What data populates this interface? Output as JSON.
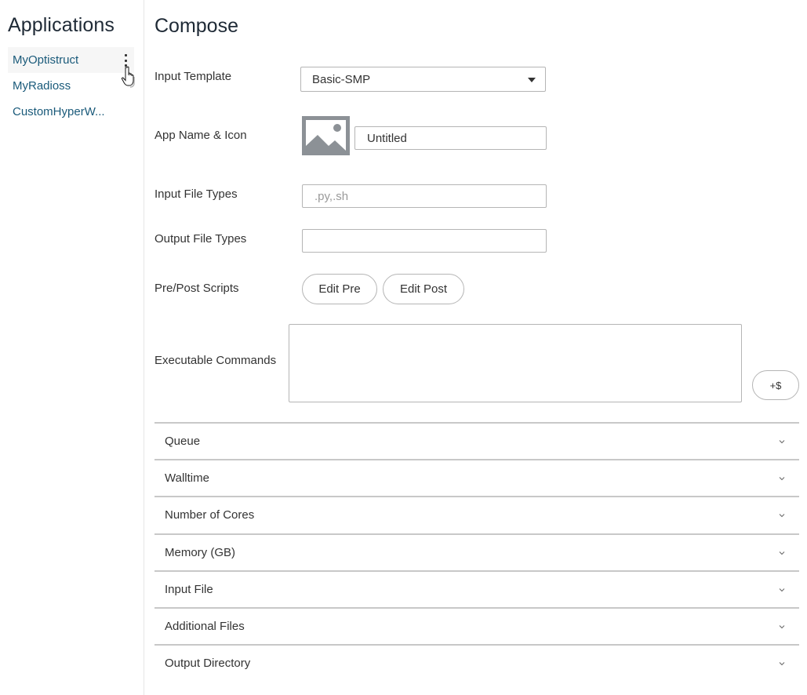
{
  "sidebar": {
    "title": "Applications",
    "items": [
      {
        "label": "MyOptistruct",
        "active": true
      },
      {
        "label": "MyRadioss",
        "active": false
      },
      {
        "label": "CustomHyperW..."
      }
    ]
  },
  "main": {
    "title": "Compose",
    "fields": {
      "input_template": {
        "label": "Input Template",
        "value": "Basic-SMP"
      },
      "app_name_icon": {
        "label": "App Name & Icon",
        "value": "Untitled"
      },
      "input_file_types": {
        "label": "Input File Types",
        "value": "",
        "placeholder": ".py,.sh"
      },
      "output_file_types": {
        "label": "Output File Types",
        "value": "",
        "placeholder": ""
      },
      "pre_post_scripts": {
        "label": "Pre/Post Scripts",
        "edit_pre": "Edit Pre",
        "edit_post": "Edit Post"
      },
      "executable_commands": {
        "label": "Executable Commands",
        "value": "",
        "add_variable": "+$"
      }
    },
    "accordion": [
      {
        "label": "Queue"
      },
      {
        "label": "Walltime"
      },
      {
        "label": "Number of Cores"
      },
      {
        "label": "Memory (GB)"
      },
      {
        "label": "Input File"
      },
      {
        "label": "Additional Files"
      },
      {
        "label": "Output Directory"
      }
    ]
  },
  "colors": {
    "link": "#1a5a7a",
    "active_bg": "#f6f6f6",
    "border": "#b5b5b5",
    "icon_gray": "#8c9196"
  }
}
